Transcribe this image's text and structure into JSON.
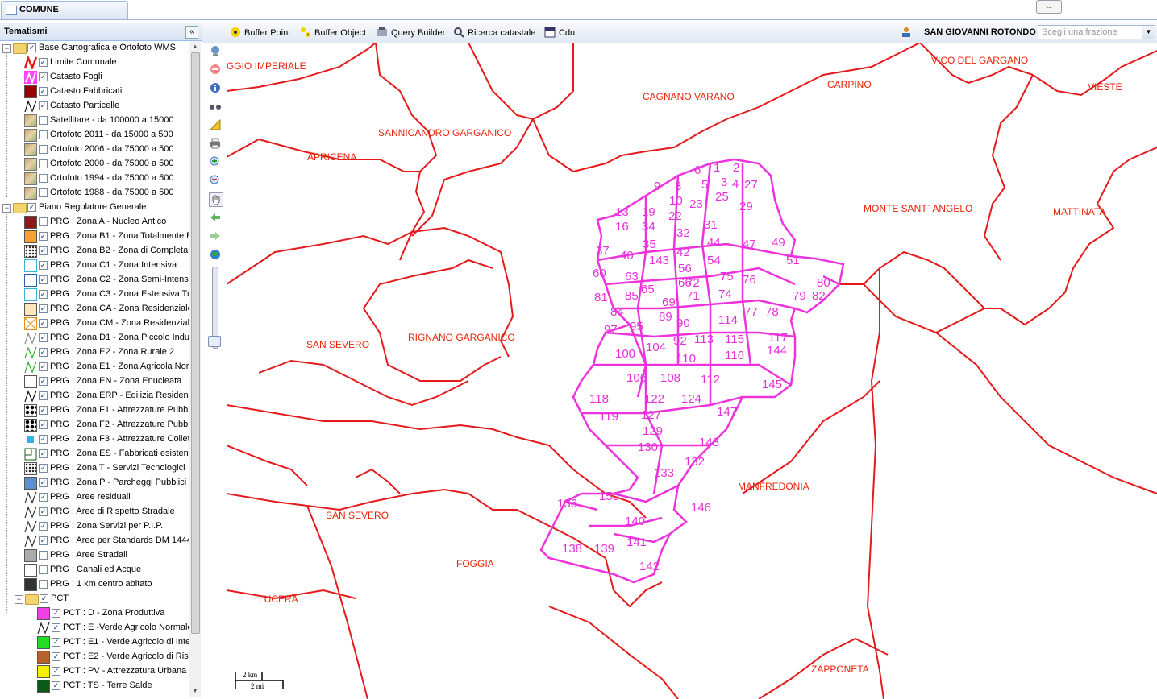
{
  "tab": {
    "label": "COMUNE"
  },
  "toggle_button": "⇔",
  "sidebar": {
    "title": "Tematismi",
    "collapse": "«",
    "groups": [
      {
        "label": "Base Cartografica e Ortofoto WMS"
      },
      {
        "label": "Piano Regolatore Generale"
      },
      {
        "label": "PCT"
      }
    ],
    "layers": [
      {
        "label": "Limite Comunale",
        "checked": true
      },
      {
        "label": "Catasto Fogli",
        "checked": true
      },
      {
        "label": "Catasto Fabbricati",
        "checked": true
      },
      {
        "label": "Catasto Particelle",
        "checked": true
      },
      {
        "label": "Satellitare - da 100000 a 15000",
        "checked": false
      },
      {
        "label": "Ortofoto 2011 - da 15000 a 500",
        "checked": false
      },
      {
        "label": "Ortofoto 2006 - da 75000 a 500",
        "checked": false
      },
      {
        "label": "Ortofoto 2000 - da 75000 a 500",
        "checked": false
      },
      {
        "label": "Ortofoto 1994 - da 75000 a 500",
        "checked": false
      },
      {
        "label": "Ortofoto 1988 - da 75000 a 500",
        "checked": false
      },
      {
        "label": "PRG : Zona A - Nucleo Antico",
        "checked": false
      },
      {
        "label": "PRG : Zona B1 - Zona Totalmente E",
        "checked": true
      },
      {
        "label": "PRG : Zona B2 - Zona di Completam",
        "checked": true
      },
      {
        "label": "PRG : Zona C1 - Zona Intensiva",
        "checked": true
      },
      {
        "label": "PRG : Zona C2 - Zona Semi-Intensiv",
        "checked": true
      },
      {
        "label": "PRG : Zona C3 - Zona Estensiva Tu",
        "checked": true
      },
      {
        "label": "PRG : Zona CA - Zona Residenziale",
        "checked": true
      },
      {
        "label": "PRG : Zona CM - Zona Residenziale",
        "checked": true
      },
      {
        "label": "PRG : Zona D1 - Zona Piccolo Indus",
        "checked": true
      },
      {
        "label": "PRG : Zona E2 - Zona Rurale 2",
        "checked": true
      },
      {
        "label": "PRG : Zona E1 - Zona Agricola Nor",
        "checked": true
      },
      {
        "label": "PRG : Zona EN - Zona Enucleata",
        "checked": true
      },
      {
        "label": "PRG : Zona ERP - Edilizia Residenzi",
        "checked": true
      },
      {
        "label": "PRG : Zona F1 - Attrezzature Pubbl",
        "checked": true
      },
      {
        "label": "PRG : Zona F2 - Attrezzature Pubbl",
        "checked": true
      },
      {
        "label": "PRG : Zona F3 - Attrezzature Collet",
        "checked": true
      },
      {
        "label": "PRG : Zona ES - Fabbricati esistent",
        "checked": true
      },
      {
        "label": "PRG : Zona T - Servizi Tecnologici",
        "checked": true
      },
      {
        "label": "PRG : Zona P - Parcheggi Pubblici",
        "checked": true
      },
      {
        "label": "PRG : Aree residuali",
        "checked": true
      },
      {
        "label": "PRG : Aree di Rispetto Stradale",
        "checked": true
      },
      {
        "label": "PRG : Zona Servizi per P.I.P.",
        "checked": true
      },
      {
        "label": "PRG : Aree per Standards DM 1444",
        "checked": true
      },
      {
        "label": "PRG : Aree Stradali",
        "checked": false
      },
      {
        "label": "PRG : Canali ed Acque",
        "checked": false
      },
      {
        "label": "PRG : 1 km centro abitato",
        "checked": false
      },
      {
        "label": "PCT : D - Zona Produttiva",
        "checked": true
      },
      {
        "label": "PCT : E -Verde Agricolo Normale",
        "checked": true
      },
      {
        "label": "PCT : E1 - Verde Agricolo di Inte",
        "checked": true
      },
      {
        "label": "PCT : E2 - Verde Agricolo di Risp",
        "checked": true
      },
      {
        "label": "PCT : PV - Attrezzatura Urbana",
        "checked": true
      },
      {
        "label": "PCT : TS - Terre Salde",
        "checked": true
      }
    ]
  },
  "toolbar": {
    "buffer_point": "Buffer Point",
    "buffer_object": "Buffer Object",
    "query_builder": "Query Builder",
    "ricerca_catastale": "Ricerca catastale",
    "cdu": "Cdu",
    "comune": "SAN GIOVANNI ROTONDO",
    "frazione_placeholder": "Scegli una frazione"
  },
  "map": {
    "municipalities": [
      "GGIO IMPERIALE",
      "CAGNANO VARANO",
      "VICO DEL GARGANO",
      "CARPINO",
      "VIESTE",
      "SANNICANDRO GARGANICO",
      "APRICENA",
      "MONTE SANT` ANGELO",
      "MATTINATA",
      "SAN SEVERO",
      "RIGNANO GARGANICO",
      "MANFREDONIA",
      "SAN SEVERO",
      "FOGGIA",
      "LUCERA",
      "ZAPPONETA"
    ],
    "sheet_numbers": [
      "1",
      "2",
      "3",
      "4",
      "5",
      "6",
      "8",
      "9",
      "10",
      "19",
      "13",
      "22",
      "23",
      "25",
      "27",
      "29",
      "16",
      "34",
      "31",
      "32",
      "44",
      "47",
      "49",
      "35",
      "37",
      "40",
      "143",
      "42",
      "56",
      "54",
      "51",
      "60",
      "63",
      "66",
      "72",
      "75",
      "76",
      "80",
      "65",
      "85",
      "69",
      "71",
      "74",
      "79",
      "81",
      "82",
      "84",
      "89",
      "77",
      "78",
      "97",
      "95",
      "90",
      "114",
      "113",
      "115",
      "117",
      "104",
      "92",
      "100",
      "110",
      "116",
      "144",
      "106",
      "108",
      "112",
      "145",
      "118",
      "122",
      "124",
      "119",
      "127",
      "147",
      "129",
      "148",
      "130",
      "132",
      "133",
      "136",
      "150",
      "146",
      "140",
      "141",
      "138",
      "139",
      "142"
    ],
    "scale": {
      "km": "2 km",
      "mi": "2 mi"
    },
    "colors": {
      "boundary": "#e41a1c",
      "sheets": "#ee33dd"
    }
  }
}
